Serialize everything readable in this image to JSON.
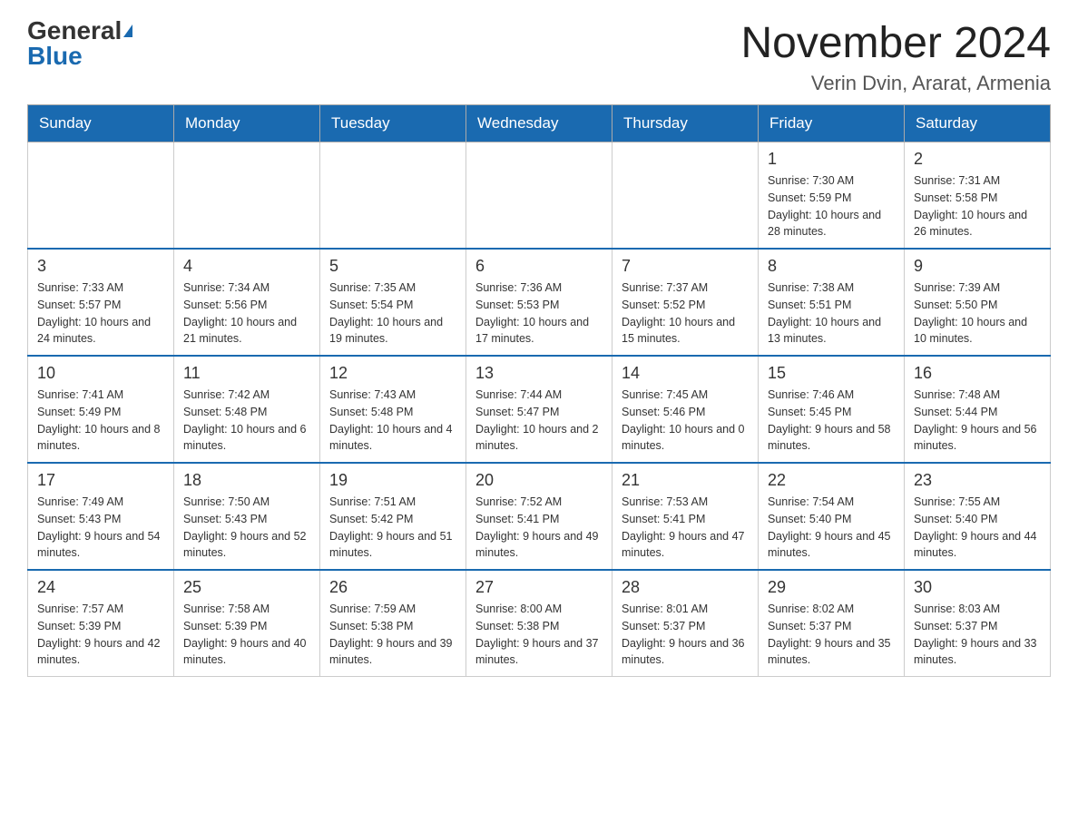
{
  "header": {
    "logo_general": "General",
    "logo_blue": "Blue",
    "title": "November 2024",
    "subtitle": "Verin Dvin, Ararat, Armenia"
  },
  "weekdays": [
    "Sunday",
    "Monday",
    "Tuesday",
    "Wednesday",
    "Thursday",
    "Friday",
    "Saturday"
  ],
  "weeks": [
    [
      {
        "day": "",
        "sunrise": "",
        "sunset": "",
        "daylight": ""
      },
      {
        "day": "",
        "sunrise": "",
        "sunset": "",
        "daylight": ""
      },
      {
        "day": "",
        "sunrise": "",
        "sunset": "",
        "daylight": ""
      },
      {
        "day": "",
        "sunrise": "",
        "sunset": "",
        "daylight": ""
      },
      {
        "day": "",
        "sunrise": "",
        "sunset": "",
        "daylight": ""
      },
      {
        "day": "1",
        "sunrise": "Sunrise: 7:30 AM",
        "sunset": "Sunset: 5:59 PM",
        "daylight": "Daylight: 10 hours and 28 minutes."
      },
      {
        "day": "2",
        "sunrise": "Sunrise: 7:31 AM",
        "sunset": "Sunset: 5:58 PM",
        "daylight": "Daylight: 10 hours and 26 minutes."
      }
    ],
    [
      {
        "day": "3",
        "sunrise": "Sunrise: 7:33 AM",
        "sunset": "Sunset: 5:57 PM",
        "daylight": "Daylight: 10 hours and 24 minutes."
      },
      {
        "day": "4",
        "sunrise": "Sunrise: 7:34 AM",
        "sunset": "Sunset: 5:56 PM",
        "daylight": "Daylight: 10 hours and 21 minutes."
      },
      {
        "day": "5",
        "sunrise": "Sunrise: 7:35 AM",
        "sunset": "Sunset: 5:54 PM",
        "daylight": "Daylight: 10 hours and 19 minutes."
      },
      {
        "day": "6",
        "sunrise": "Sunrise: 7:36 AM",
        "sunset": "Sunset: 5:53 PM",
        "daylight": "Daylight: 10 hours and 17 minutes."
      },
      {
        "day": "7",
        "sunrise": "Sunrise: 7:37 AM",
        "sunset": "Sunset: 5:52 PM",
        "daylight": "Daylight: 10 hours and 15 minutes."
      },
      {
        "day": "8",
        "sunrise": "Sunrise: 7:38 AM",
        "sunset": "Sunset: 5:51 PM",
        "daylight": "Daylight: 10 hours and 13 minutes."
      },
      {
        "day": "9",
        "sunrise": "Sunrise: 7:39 AM",
        "sunset": "Sunset: 5:50 PM",
        "daylight": "Daylight: 10 hours and 10 minutes."
      }
    ],
    [
      {
        "day": "10",
        "sunrise": "Sunrise: 7:41 AM",
        "sunset": "Sunset: 5:49 PM",
        "daylight": "Daylight: 10 hours and 8 minutes."
      },
      {
        "day": "11",
        "sunrise": "Sunrise: 7:42 AM",
        "sunset": "Sunset: 5:48 PM",
        "daylight": "Daylight: 10 hours and 6 minutes."
      },
      {
        "day": "12",
        "sunrise": "Sunrise: 7:43 AM",
        "sunset": "Sunset: 5:48 PM",
        "daylight": "Daylight: 10 hours and 4 minutes."
      },
      {
        "day": "13",
        "sunrise": "Sunrise: 7:44 AM",
        "sunset": "Sunset: 5:47 PM",
        "daylight": "Daylight: 10 hours and 2 minutes."
      },
      {
        "day": "14",
        "sunrise": "Sunrise: 7:45 AM",
        "sunset": "Sunset: 5:46 PM",
        "daylight": "Daylight: 10 hours and 0 minutes."
      },
      {
        "day": "15",
        "sunrise": "Sunrise: 7:46 AM",
        "sunset": "Sunset: 5:45 PM",
        "daylight": "Daylight: 9 hours and 58 minutes."
      },
      {
        "day": "16",
        "sunrise": "Sunrise: 7:48 AM",
        "sunset": "Sunset: 5:44 PM",
        "daylight": "Daylight: 9 hours and 56 minutes."
      }
    ],
    [
      {
        "day": "17",
        "sunrise": "Sunrise: 7:49 AM",
        "sunset": "Sunset: 5:43 PM",
        "daylight": "Daylight: 9 hours and 54 minutes."
      },
      {
        "day": "18",
        "sunrise": "Sunrise: 7:50 AM",
        "sunset": "Sunset: 5:43 PM",
        "daylight": "Daylight: 9 hours and 52 minutes."
      },
      {
        "day": "19",
        "sunrise": "Sunrise: 7:51 AM",
        "sunset": "Sunset: 5:42 PM",
        "daylight": "Daylight: 9 hours and 51 minutes."
      },
      {
        "day": "20",
        "sunrise": "Sunrise: 7:52 AM",
        "sunset": "Sunset: 5:41 PM",
        "daylight": "Daylight: 9 hours and 49 minutes."
      },
      {
        "day": "21",
        "sunrise": "Sunrise: 7:53 AM",
        "sunset": "Sunset: 5:41 PM",
        "daylight": "Daylight: 9 hours and 47 minutes."
      },
      {
        "day": "22",
        "sunrise": "Sunrise: 7:54 AM",
        "sunset": "Sunset: 5:40 PM",
        "daylight": "Daylight: 9 hours and 45 minutes."
      },
      {
        "day": "23",
        "sunrise": "Sunrise: 7:55 AM",
        "sunset": "Sunset: 5:40 PM",
        "daylight": "Daylight: 9 hours and 44 minutes."
      }
    ],
    [
      {
        "day": "24",
        "sunrise": "Sunrise: 7:57 AM",
        "sunset": "Sunset: 5:39 PM",
        "daylight": "Daylight: 9 hours and 42 minutes."
      },
      {
        "day": "25",
        "sunrise": "Sunrise: 7:58 AM",
        "sunset": "Sunset: 5:39 PM",
        "daylight": "Daylight: 9 hours and 40 minutes."
      },
      {
        "day": "26",
        "sunrise": "Sunrise: 7:59 AM",
        "sunset": "Sunset: 5:38 PM",
        "daylight": "Daylight: 9 hours and 39 minutes."
      },
      {
        "day": "27",
        "sunrise": "Sunrise: 8:00 AM",
        "sunset": "Sunset: 5:38 PM",
        "daylight": "Daylight: 9 hours and 37 minutes."
      },
      {
        "day": "28",
        "sunrise": "Sunrise: 8:01 AM",
        "sunset": "Sunset: 5:37 PM",
        "daylight": "Daylight: 9 hours and 36 minutes."
      },
      {
        "day": "29",
        "sunrise": "Sunrise: 8:02 AM",
        "sunset": "Sunset: 5:37 PM",
        "daylight": "Daylight: 9 hours and 35 minutes."
      },
      {
        "day": "30",
        "sunrise": "Sunrise: 8:03 AM",
        "sunset": "Sunset: 5:37 PM",
        "daylight": "Daylight: 9 hours and 33 minutes."
      }
    ]
  ]
}
